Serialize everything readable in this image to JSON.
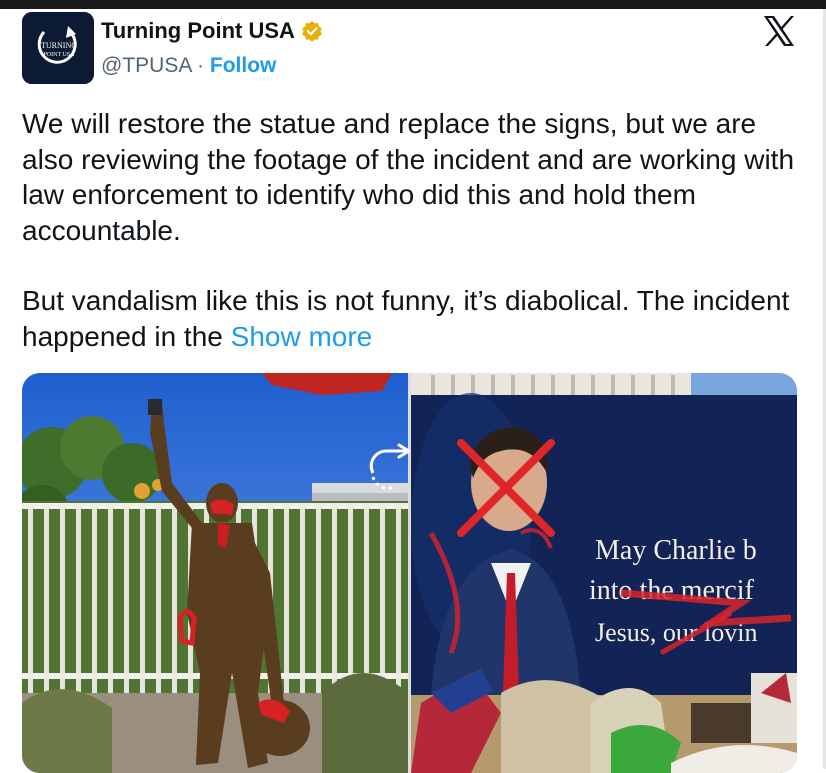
{
  "account": {
    "name": "Turning Point USA",
    "handle": "@TPUSA",
    "separator": "·",
    "follow_label": "Follow",
    "avatar_text_1": "TURNING",
    "avatar_text_2": "POINT USA"
  },
  "tweet": {
    "paragraph1": "We will restore the statue and replace the signs, but we are also reviewing the footage of the incident and are working with law enforcement to identify who did this and hold them accountable.",
    "paragraph2": "But vandalism like this is not funny, it’s diabolical. The incident happened in the ",
    "show_more": "Show more"
  },
  "media": {
    "image2_sign_line1": "May Charlie b",
    "image2_sign_line2": "into the mercif",
    "image2_sign_line3": "Jesus, our lovin"
  },
  "icons": [
    "verified-badge-icon",
    "x-logo-icon",
    "repost-icon"
  ],
  "colors": {
    "accent": "#1d9bf0",
    "badge": "#e8b007",
    "text": "#0f1419",
    "muted": "#536471"
  }
}
